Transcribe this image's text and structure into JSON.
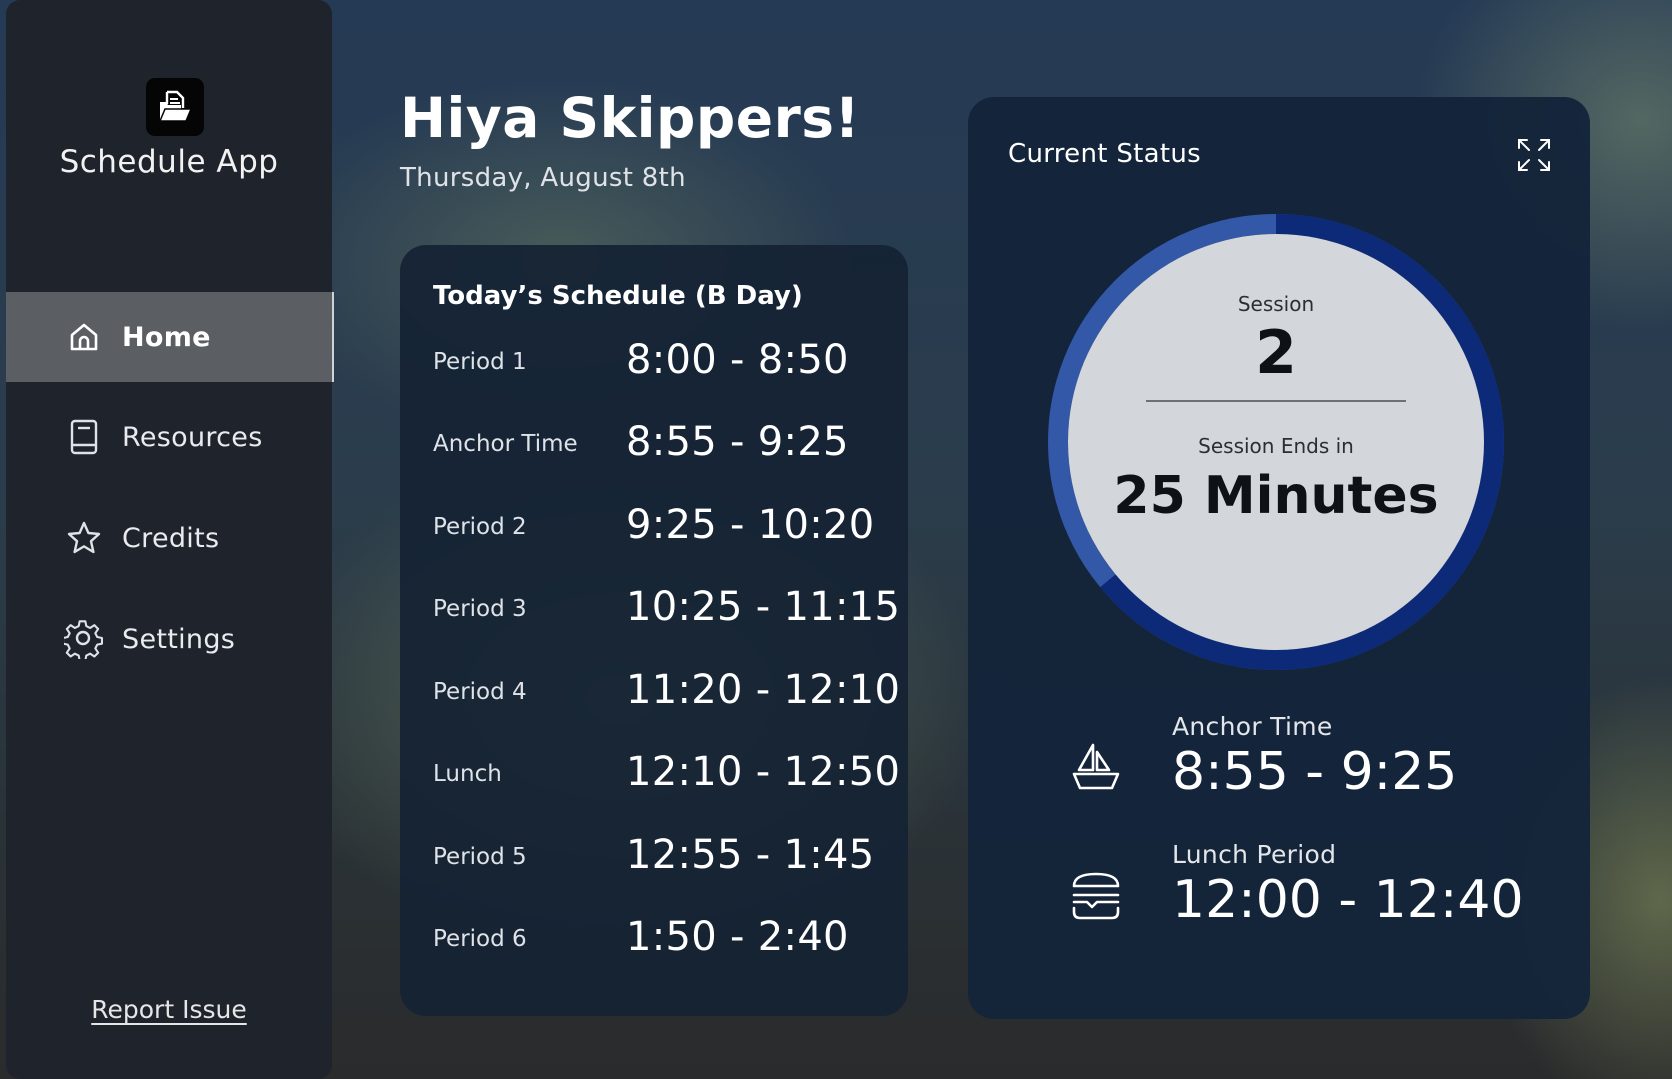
{
  "app": {
    "name": "Schedule App",
    "logo_icon": "folder-document-icon"
  },
  "sidebar": {
    "items": [
      {
        "label": "Home",
        "icon": "home-icon",
        "active": true
      },
      {
        "label": "Resources",
        "icon": "book-icon",
        "active": false
      },
      {
        "label": "Credits",
        "icon": "star-icon",
        "active": false
      },
      {
        "label": "Settings",
        "icon": "gear-icon",
        "active": false
      }
    ],
    "report_label": "Report Issue"
  },
  "header": {
    "greeting": "Hiya Skippers!",
    "date": "Thursday, August 8th"
  },
  "schedule": {
    "title": "Today’s Schedule (B Day)",
    "rows": [
      {
        "label": "Period 1",
        "time": "8:00 - 8:50"
      },
      {
        "label": "Anchor Time",
        "time": "8:55 - 9:25"
      },
      {
        "label": "Period 2",
        "time": "9:25 - 10:20"
      },
      {
        "label": "Period 3",
        "time": "10:25 - 11:15"
      },
      {
        "label": "Period 4",
        "time": "11:20 - 12:10"
      },
      {
        "label": "Lunch",
        "time": "12:10 - 12:50"
      },
      {
        "label": "Period 5",
        "time": "12:55 - 1:45"
      },
      {
        "label": "Period 6",
        "time": "1:50 - 2:40"
      }
    ]
  },
  "status": {
    "title": "Current Status",
    "expand_icon": "expand-icon",
    "session_label": "Session",
    "session_number": "2",
    "ends_label": "Session Ends in",
    "ends_value": "25 Minutes",
    "progress_fraction": 0.64,
    "colors": {
      "ring_elapsed": "#3358a8",
      "ring_remaining": "#0c2a78",
      "inner": "#d3d6da"
    },
    "anchor": {
      "label": "Anchor Time",
      "time": "8:55 - 9:25",
      "icon": "sailboat-icon"
    },
    "lunch": {
      "label": "Lunch Period",
      "time": "12:00 - 12:40",
      "icon": "burger-icon"
    }
  }
}
